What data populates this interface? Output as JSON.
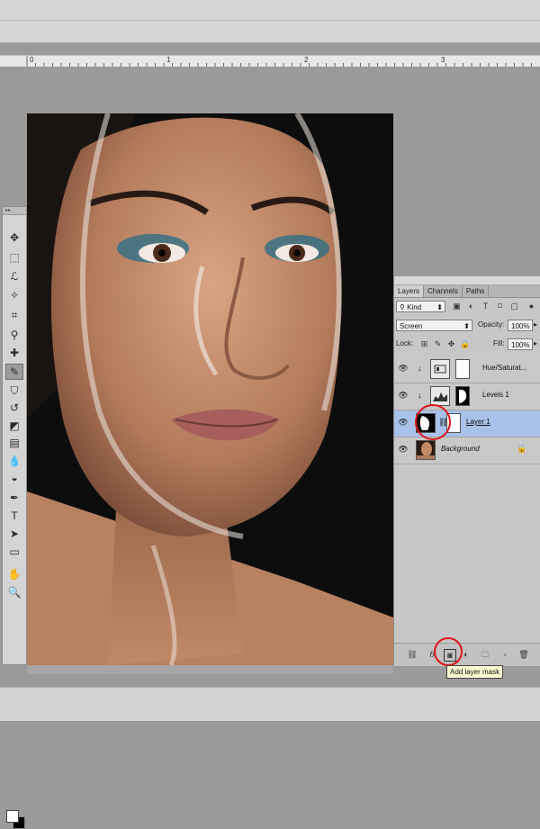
{
  "ruler": {
    "ticks": [
      "0",
      "1",
      "2",
      "3"
    ]
  },
  "toolbox": {
    "grip": "▸▸",
    "tools": [
      {
        "name": "move-tool",
        "glyph": "✥"
      },
      {
        "name": "marquee-tool",
        "glyph": "⬚"
      },
      {
        "name": "lasso-tool",
        "glyph": "ℒ"
      },
      {
        "name": "quick-select-tool",
        "glyph": "✧"
      },
      {
        "name": "crop-tool",
        "glyph": "⌗"
      },
      {
        "name": "eyedropper-tool",
        "glyph": "⚲"
      },
      {
        "name": "healing-brush-tool",
        "glyph": "✚"
      },
      {
        "name": "brush-tool",
        "glyph": "✎",
        "active": true
      },
      {
        "name": "clone-stamp-tool",
        "glyph": "⛉"
      },
      {
        "name": "history-brush-tool",
        "glyph": "↺"
      },
      {
        "name": "eraser-tool",
        "glyph": "◩"
      },
      {
        "name": "gradient-tool",
        "glyph": "▤"
      },
      {
        "name": "blur-tool",
        "glyph": "💧"
      },
      {
        "name": "dodge-tool",
        "glyph": "◒"
      },
      {
        "name": "pen-tool",
        "glyph": "✒"
      },
      {
        "name": "type-tool",
        "glyph": "T"
      },
      {
        "name": "path-select-tool",
        "glyph": "➤"
      },
      {
        "name": "shape-tool",
        "glyph": "▭"
      },
      {
        "name": "hand-tool",
        "glyph": "✋"
      },
      {
        "name": "zoom-tool",
        "glyph": "🔍"
      }
    ]
  },
  "layers_panel": {
    "tabs": [
      "Layers",
      "Channels",
      "Paths"
    ],
    "active_tab": "Layers",
    "filter_kind": "Kind",
    "blend_mode": "Screen",
    "opacity_label": "Opacity:",
    "opacity_value": "100%",
    "lock_label": "Lock:",
    "fill_label": "Fill:",
    "fill_value": "100%",
    "layers": [
      {
        "name": "Hue/Saturat...",
        "selected": false,
        "type": "adjustment"
      },
      {
        "name": "Levels 1",
        "selected": false,
        "type": "adjustment"
      },
      {
        "name": "Layer 1",
        "selected": true,
        "type": "pixel"
      },
      {
        "name": "Background",
        "selected": false,
        "type": "background",
        "locked": true
      }
    ],
    "tooltip": "Add layer mask"
  },
  "colors": {
    "highlight": "#e1141b",
    "selection": "#a8c1e8",
    "canvas_bg": "#0d0d0d"
  }
}
